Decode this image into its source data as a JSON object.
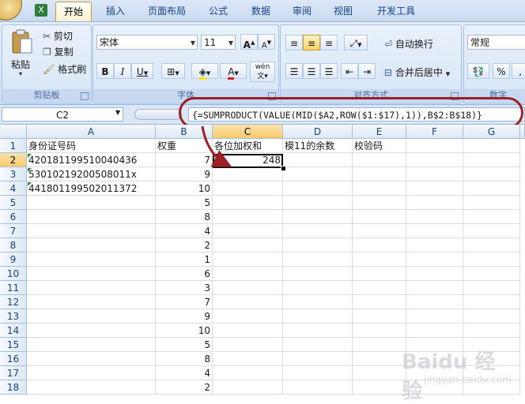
{
  "tabs": [
    "开始",
    "插入",
    "页面布局",
    "公式",
    "数据",
    "审阅",
    "视图",
    "开发工具"
  ],
  "active_tab": "开始",
  "ribbon": {
    "clipboard": {
      "paste": "粘贴",
      "cut": "剪切",
      "copy": "复制",
      "format_painter": "格式刷",
      "label": "剪贴板"
    },
    "font": {
      "name": "宋体",
      "size": "11",
      "label": "字体",
      "bold": "B",
      "italic": "I",
      "underline": "U",
      "grow": "A",
      "shrink": "A",
      "font_color": "A",
      "phonetic": "wén"
    },
    "alignment": {
      "wrap": "自动换行",
      "merge": "合并后居中",
      "label": "对齐方式"
    },
    "number": {
      "format": "常规",
      "percent": "%",
      "comma": ",",
      "label": "数字"
    }
  },
  "formula_bar": {
    "name_box": "C2",
    "formula": "{=SUMPRODUCT(VALUE(MID($A2,ROW($1:$17),1)),B$2:B$18)}"
  },
  "columns": [
    "A",
    "B",
    "C",
    "D",
    "E",
    "F",
    "G"
  ],
  "rows": [
    {
      "n": "1",
      "a": "身份证号码",
      "b": "权重",
      "c": "各位加权和",
      "d": "模11的余数",
      "e": "校验码"
    },
    {
      "n": "2",
      "a": "420181199510040436",
      "b": "7",
      "c": "248"
    },
    {
      "n": "3",
      "a": "53010219200508011x",
      "b": "9"
    },
    {
      "n": "4",
      "a": "441801199502011372",
      "b": "10"
    },
    {
      "n": "5",
      "b": "5"
    },
    {
      "n": "6",
      "b": "8"
    },
    {
      "n": "7",
      "b": "4"
    },
    {
      "n": "8",
      "b": "2"
    },
    {
      "n": "9",
      "b": "1"
    },
    {
      "n": "10",
      "b": "6"
    },
    {
      "n": "11",
      "b": "3"
    },
    {
      "n": "12",
      "b": "7"
    },
    {
      "n": "13",
      "b": "9"
    },
    {
      "n": "14",
      "b": "10"
    },
    {
      "n": "15",
      "b": "5"
    },
    {
      "n": "16",
      "b": "8"
    },
    {
      "n": "17",
      "b": "4"
    },
    {
      "n": "18",
      "b": "2"
    }
  ],
  "active_cell": "C2",
  "watermark": {
    "main": "Baidu 经验",
    "sub": "jingyan.baidu.com"
  },
  "colors": {
    "annotation": "#9c1f28",
    "header_selected": "#f8c96a",
    "ribbon": "#cfe0f3"
  }
}
